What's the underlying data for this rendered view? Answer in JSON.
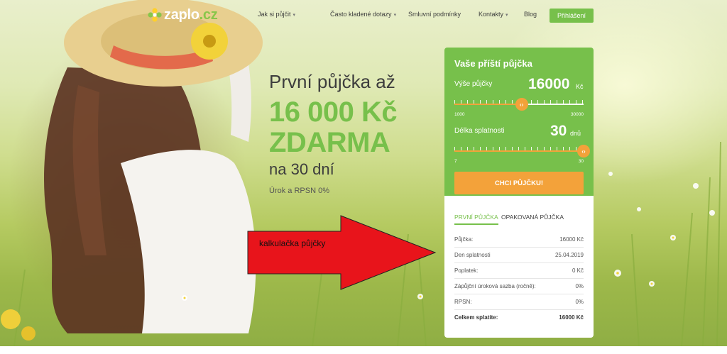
{
  "brand": {
    "name": "zaplo",
    "tld": ".cz",
    "colors": {
      "primary": "#77c04b",
      "accent": "#f3a23a",
      "text": "#3d3d3d"
    }
  },
  "nav": {
    "items": [
      {
        "label": "Jak si půjčit",
        "has_dropdown": true
      },
      {
        "label": "Často kladené dotazy",
        "has_dropdown": true
      },
      {
        "label": "Smluvní podmínky",
        "has_dropdown": false
      },
      {
        "label": "Kontakty",
        "has_dropdown": true
      },
      {
        "label": "Blog",
        "has_dropdown": false
      }
    ],
    "dropdown_icon": "chevron-down-icon",
    "login_label": "Přihlášení"
  },
  "hero": {
    "line1": "První půjčka až",
    "line2": "16 000 Kč",
    "line3": "ZDARMA",
    "line4": "na 30 dní",
    "rate_note": "Úrok a RPSN 0%"
  },
  "annotation": {
    "label": "kalkulačka půjčky"
  },
  "calculator": {
    "title": "Vaše příští půjčka",
    "amount": {
      "label": "Výše půjčky",
      "value": "16000",
      "unit": "Kč",
      "min": "1000",
      "max": "30000",
      "fraction": 0.52
    },
    "term": {
      "label": "Délka splatnosti",
      "value": "30",
      "unit": "dnů",
      "min": "7",
      "max": "30",
      "fraction": 1.0
    },
    "thumb_glyph": "‹›",
    "cta_label": "CHCI PŮJČKU!"
  },
  "summary": {
    "tabs": [
      {
        "label": "PRVNÍ PŮJČKA",
        "active": true
      },
      {
        "label": "OPAKOVANÁ PŮJČKA",
        "active": false
      }
    ],
    "rows": [
      {
        "label": "Půjčka:",
        "value": "16000 Kč"
      },
      {
        "label": "Den splatnosti",
        "value": "25.04.2019"
      },
      {
        "label": "Poplatek:",
        "value": "0 Kč"
      },
      {
        "label": "Zápůjční úroková sazba (ročně):",
        "value": "0%"
      },
      {
        "label": "RPSN:",
        "value": "0%"
      },
      {
        "label": "Celkem splatíte:",
        "value": "16000 Kč"
      }
    ]
  }
}
